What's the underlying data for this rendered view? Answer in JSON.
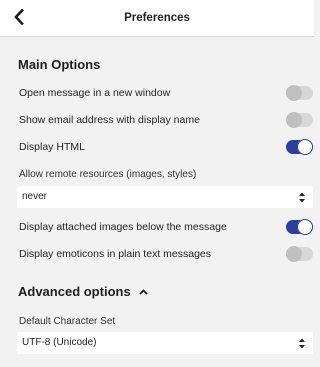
{
  "header": {
    "title": "Preferences",
    "back_icon": "chevron-left-icon"
  },
  "main_options": {
    "title": "Main Options",
    "open_new_window": {
      "label": "Open message in a new window",
      "on": false
    },
    "show_email": {
      "label": "Show email address with display name",
      "on": false
    },
    "display_html": {
      "label": "Display HTML",
      "on": true
    },
    "remote_resources": {
      "label": "Allow remote resources (images, styles)",
      "value": "never"
    },
    "attached_images": {
      "label": "Display attached images below the message",
      "on": true
    },
    "emoticons": {
      "label": "Display emoticons in plain text messages",
      "on": false
    }
  },
  "advanced_options": {
    "title": "Advanced options",
    "charset": {
      "label": "Default Character Set",
      "value": "UTF-8 (Unicode)"
    }
  },
  "colors": {
    "accent": "#2d3f9e",
    "background": "#f2f2f2",
    "toggle_off": "#d7d7d7"
  }
}
